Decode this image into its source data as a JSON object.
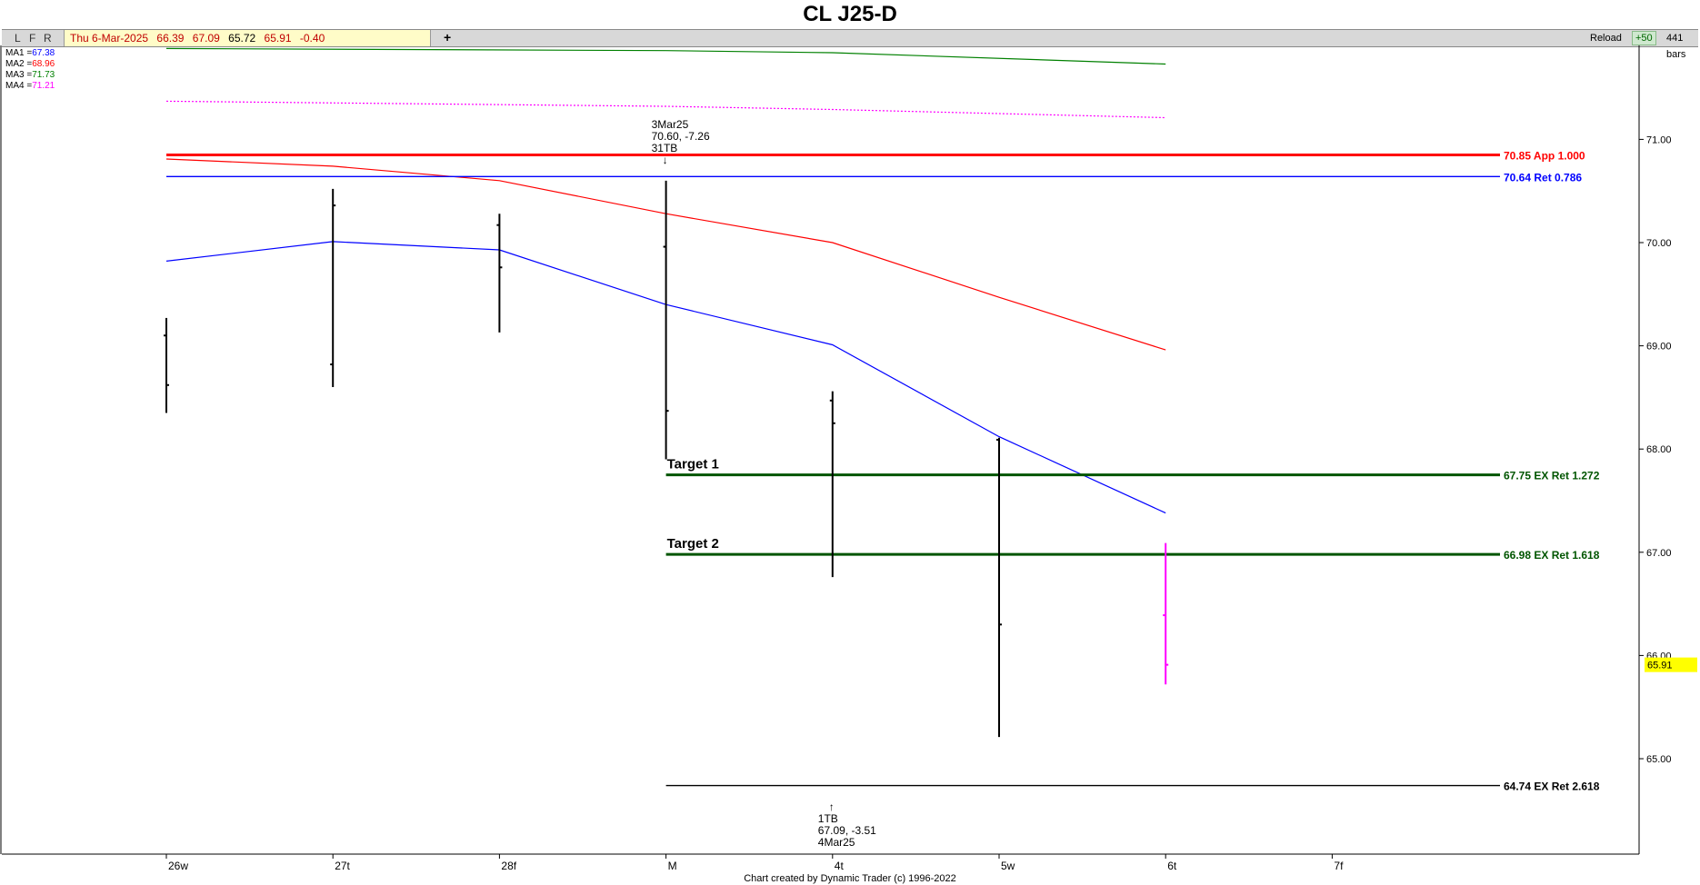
{
  "title": "CL J25-D",
  "toolbar": {
    "buttons": [
      "L",
      "F",
      "R"
    ],
    "quote": {
      "date": "Thu 6-Mar-2025",
      "open": "66.39",
      "high": "67.09",
      "close": "65.72",
      "low": "65.91",
      "change": "-0.40"
    },
    "crosshair": "+",
    "reload_label": "Reload",
    "plus_label": "+50",
    "bars_label": "441 bars"
  },
  "ma_legend": [
    {
      "label": "MA1 =",
      "value": "67.38",
      "color": "#0000ff"
    },
    {
      "label": "MA2 =",
      "value": "68.96",
      "color": "#ff0000"
    },
    {
      "label": "MA3 =",
      "value": "71.73",
      "color": "#008000"
    },
    {
      "label": "MA4 =",
      "value": "71.21",
      "color": "#ff00ff"
    }
  ],
  "footer": "Chart created by Dynamic Trader  (c) 1996-2022",
  "chart_data": {
    "type": "ohlc",
    "categories": [
      "26w",
      "27t",
      "28f",
      "M",
      "4t",
      "5w",
      "6t",
      "7f"
    ],
    "ylim": [
      64.1,
      71.9
    ],
    "y_ticks": [
      "65.00",
      "66.00",
      "67.00",
      "68.00",
      "69.00",
      "70.00",
      "71.00"
    ],
    "last_price": "65.91",
    "last_price_color": "#ffff00",
    "bars": [
      {
        "x": "26w",
        "open": 69.1,
        "high": 69.27,
        "low": 68.35,
        "close": 68.62,
        "color": "#000000"
      },
      {
        "x": "27t",
        "open": 68.82,
        "high": 70.52,
        "low": 68.6,
        "close": 70.36,
        "color": "#000000"
      },
      {
        "x": "28f",
        "open": 70.17,
        "high": 70.28,
        "low": 69.13,
        "close": 69.76,
        "color": "#000000"
      },
      {
        "x": "M",
        "open": 69.96,
        "high": 70.6,
        "low": 67.9,
        "close": 68.37,
        "color": "#000000"
      },
      {
        "x": "4t",
        "open": 68.47,
        "high": 68.56,
        "low": 66.76,
        "close": 68.25,
        "color": "#000000"
      },
      {
        "x": "5w",
        "open": 68.09,
        "high": 68.11,
        "low": 65.21,
        "close": 66.3,
        "color": "#000000"
      },
      {
        "x": "6t",
        "open": 66.39,
        "high": 67.09,
        "low": 65.72,
        "close": 65.91,
        "color": "#ff00ff"
      }
    ],
    "moving_averages": [
      {
        "name": "MA1",
        "color": "#0000ff",
        "dashed": false,
        "points": [
          [
            "26w",
            69.82
          ],
          [
            "27t",
            70.01
          ],
          [
            "28f",
            69.93
          ],
          [
            "M",
            69.4
          ],
          [
            "4t",
            69.01
          ],
          [
            "5w",
            68.12
          ],
          [
            "6t",
            67.38
          ]
        ]
      },
      {
        "name": "MA2",
        "color": "#ff0000",
        "dashed": false,
        "points": [
          [
            "26w",
            70.81
          ],
          [
            "27t",
            70.74
          ],
          [
            "28f",
            70.6
          ],
          [
            "M",
            70.28
          ],
          [
            "4t",
            70.0
          ],
          [
            "5w",
            69.47
          ],
          [
            "6t",
            68.96
          ]
        ]
      },
      {
        "name": "MA3",
        "color": "#008000",
        "dashed": false,
        "points": [
          [
            "26w",
            71.88
          ],
          [
            "M",
            71.86
          ],
          [
            "4t",
            71.84
          ],
          [
            "6t",
            71.73
          ]
        ]
      },
      {
        "name": "MA4",
        "color": "#ff00ff",
        "dashed": true,
        "points": [
          [
            "26w",
            71.37
          ],
          [
            "M",
            71.32
          ],
          [
            "4t",
            71.29
          ],
          [
            "6t",
            71.21
          ]
        ]
      }
    ],
    "levels": [
      {
        "value": 70.85,
        "label": "70.85 App 1.000",
        "color": "#ff0000",
        "thick": true,
        "from": "26w"
      },
      {
        "value": 70.64,
        "label": "70.64 Ret 0.786",
        "color": "#0000ff",
        "thick": false,
        "from": "26w"
      },
      {
        "value": 67.75,
        "label": "67.75 EX Ret 1.272",
        "color": "#005500",
        "thick": true,
        "from": "M",
        "tag": "Target 1"
      },
      {
        "value": 66.98,
        "label": "66.98 EX Ret 1.618",
        "color": "#005500",
        "thick": true,
        "from": "M",
        "tag": "Target 2"
      },
      {
        "value": 64.74,
        "label": "64.74 EX Ret 2.618",
        "color": "#000000",
        "thick": false,
        "from": "M"
      }
    ],
    "annotations": [
      {
        "x": "M",
        "price": 70.6,
        "position": "above",
        "lines": [
          "3Mar25",
          "70.60, -7.26",
          "31TB"
        ],
        "arrow": "↓"
      },
      {
        "x": "4t",
        "price": 66.76,
        "position": "below",
        "lines": [
          "1TB",
          "67.09, -3.51",
          "4Mar25"
        ],
        "arrow": "↑"
      }
    ]
  }
}
